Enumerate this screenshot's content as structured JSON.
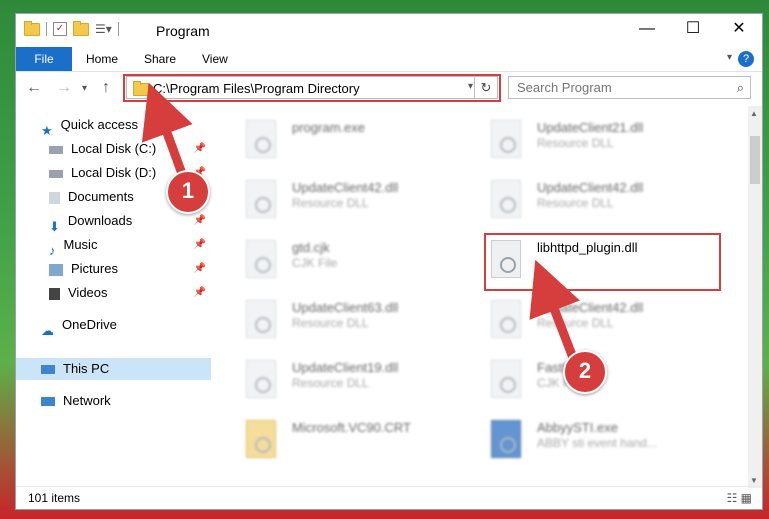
{
  "window": {
    "title": "Program",
    "controls": {
      "minimize": "—",
      "maximize": "☐",
      "close": "✕"
    }
  },
  "ribbon": {
    "tabs": [
      "File",
      "Home",
      "Share",
      "View"
    ],
    "help": "?"
  },
  "navigation": {
    "address": "C:\\Program Files\\Program Directory",
    "search_placeholder": "Search Program"
  },
  "sidebar": {
    "quick_access": "Quick access",
    "items": [
      {
        "label": "Local Disk (C:)",
        "pinned": true
      },
      {
        "label": "Local Disk (D:)",
        "pinned": true
      },
      {
        "label": "Documents",
        "pinned": true
      },
      {
        "label": "Downloads",
        "pinned": true
      },
      {
        "label": "Music",
        "pinned": true
      },
      {
        "label": "Pictures",
        "pinned": true
      },
      {
        "label": "Videos",
        "pinned": true
      }
    ],
    "onedrive": "OneDrive",
    "this_pc": "This PC",
    "network": "Network"
  },
  "files": [
    {
      "name": "program.exe",
      "type": ""
    },
    {
      "name": "UpdateClient21.dll",
      "type": "Resource DLL"
    },
    {
      "name": "UpdateClient42.dll",
      "type": "Resource DLL"
    },
    {
      "name": "UpdateClient42.dll",
      "type": "Resource DLL"
    },
    {
      "name": "gtd.cjk",
      "type": "CJK File"
    },
    {
      "name": "libhttpd_plugin.dll",
      "type": ""
    },
    {
      "name": "UpdateClient63.dll",
      "type": "Resource DLL"
    },
    {
      "name": "UpdateClient42.dll",
      "type": "Resource DLL"
    },
    {
      "name": "UpdateClient19.dll",
      "type": "Resource DLL"
    },
    {
      "name": "FastK...",
      "type": "CJK File"
    },
    {
      "name": "Microsoft.VC90.CRT",
      "type": ""
    },
    {
      "name": "AbbyySTI.exe",
      "type": "ABBY sti event hand..."
    }
  ],
  "annotations": {
    "step1": "1",
    "step2": "2"
  },
  "status": {
    "items": "101 items"
  },
  "colors": {
    "accent": "#1a6fc9",
    "annotation": "#d63d3d"
  }
}
